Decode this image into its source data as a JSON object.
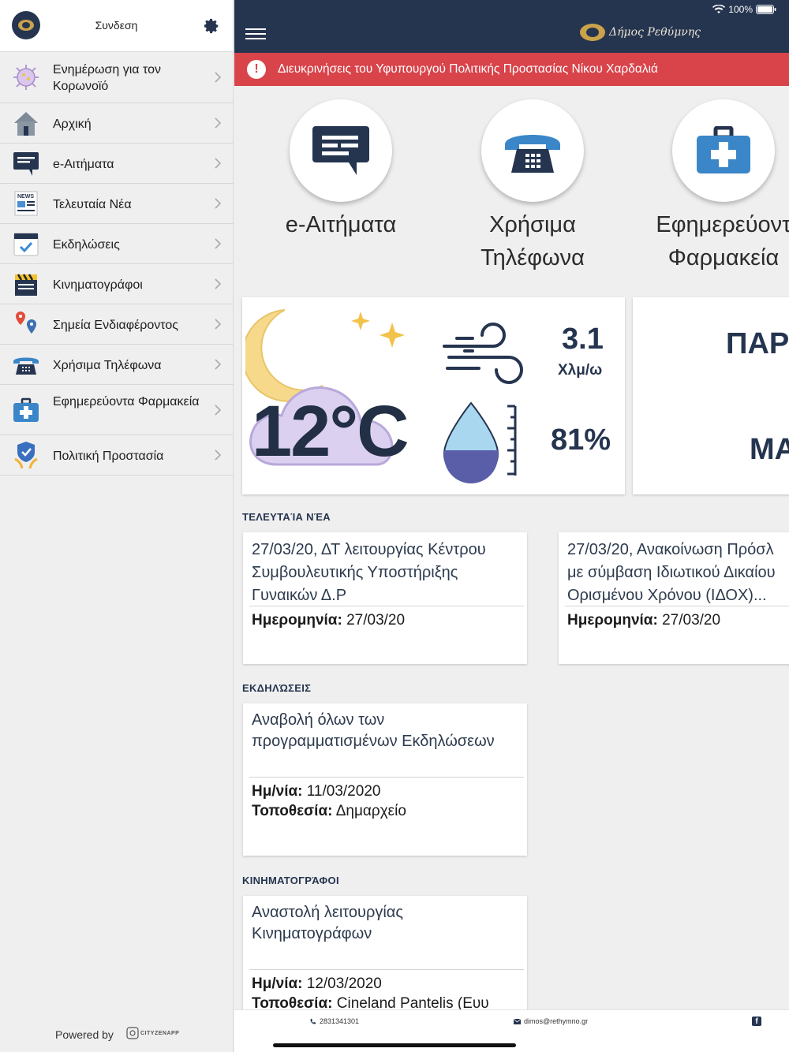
{
  "status_bar": {
    "battery": "100%"
  },
  "sidebar": {
    "login_label": "Συνδεση",
    "items": [
      {
        "label": "Ενημέρωση για τον Κορωνοϊό",
        "icon": "virus-icon"
      },
      {
        "label": "Αρχική",
        "icon": "home-icon"
      },
      {
        "label": "e-Αιτήματα",
        "icon": "chat-icon"
      },
      {
        "label": "Τελευταία Νέα",
        "icon": "newspaper-icon"
      },
      {
        "label": "Εκδηλώσεις",
        "icon": "calendar-icon"
      },
      {
        "label": "Κινηματογράφοι",
        "icon": "clapperboard-icon"
      },
      {
        "label": "Σημεία Ενδιαφέροντος",
        "icon": "map-pin-icon"
      },
      {
        "label": "Χρήσιμα Τηλέφωνα",
        "icon": "telephone-icon"
      },
      {
        "label": "Εφημερεύοντα Φαρμακεία",
        "icon": "first-aid-kit-icon"
      },
      {
        "label": "Πολιτική Προστασία",
        "icon": "shield-icon"
      }
    ],
    "powered_by": "Powered by",
    "powered_logo_text": "CITYZENAPP"
  },
  "header": {
    "brand": "Δήμος Ρεθύμνης"
  },
  "alert": {
    "text": "Διευκρινήσεις του Υφυπουργού Πολιτικής Προστασίας Νίκου Χαρδαλιά"
  },
  "quick_actions": [
    {
      "line1": "e-Αιτήματα",
      "line2": "",
      "icon": "chat-icon"
    },
    {
      "line1": "Χρήσιμα",
      "line2": "Τηλέφωνα",
      "icon": "telephone-icon"
    },
    {
      "line1": "Εφημερεύοντ",
      "line2": "Φαρμακεία",
      "icon": "first-aid-kit-icon"
    }
  ],
  "weather": {
    "temperature": "12°C",
    "wind": "3.1",
    "wind_unit": "Χλμ/ω",
    "humidity": "81%"
  },
  "card2": {
    "line1": "ΠΑΡ",
    "line2": "ΜΑ"
  },
  "news": {
    "title": "ΤΕΛΕΥΤΑΊΑ ΝΈΑ",
    "date_label": "Ημερομηνία:",
    "items": [
      {
        "title": "27/03/20, ΔΤ λειτουργίας Κέντρου Συμβουλευτικής Υποστήριξης Γυναικών Δ.Ρ",
        "date": "27/03/20"
      },
      {
        "title_l1": "27/03/20, Ανακοίνωση Πρόσλ",
        "title_l2": "με σύμβαση Ιδιωτικού Δικαίου",
        "title_l3": "Ορισμένου Χρόνου (ΙΔΟΧ)...",
        "date": "27/03/20"
      }
    ]
  },
  "events": {
    "title": "ΕΚΔΗΛΏΣΕΙΣ",
    "item": {
      "title": "Αναβολή όλων των προγραμματισμένων Εκδηλώσεων",
      "date_label": "Ημ/νία:",
      "date": "11/03/2020",
      "place_label": "Τοποθεσία:",
      "place": "Δημαρχείο"
    }
  },
  "cinemas": {
    "title": "ΚΙΝΗΜΑΤΟΓΡΆΦΟΙ",
    "item": {
      "title": "Αναστολή λειτουργίας Κινηματογράφων",
      "date_label": "Ημ/νία:",
      "date": "12/03/2020",
      "place_label": "Τοποθεσία:",
      "place": "Cineland Pantelis (Ευυ"
    }
  },
  "footer": {
    "phone": "2831341301",
    "email": "dimos@rethymno.gr"
  },
  "colors": {
    "navy": "#25344f",
    "alert_red": "#d9434a",
    "background": "#efefef"
  }
}
